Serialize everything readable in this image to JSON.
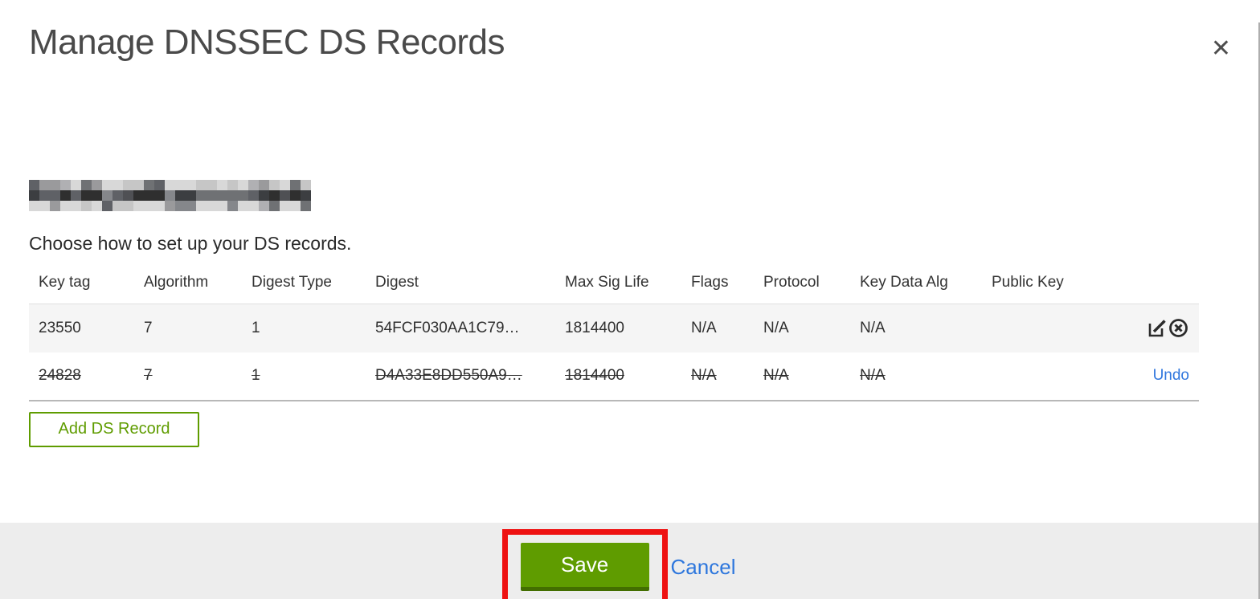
{
  "modal": {
    "title": "Manage DNSSEC DS Records",
    "close_icon": "✕",
    "intro": "Choose how to set up your DS records."
  },
  "redacted_domain": {
    "present": true,
    "palette": [
      "#2f2f2f",
      "#3c3e41",
      "#4f5054",
      "#5f6166",
      "#6f7174",
      "#85878b",
      "#9a9a9c",
      "#b0b0b3",
      "#c6c6c6",
      "#d8d8d8"
    ]
  },
  "table": {
    "headers": [
      "Key tag",
      "Algorithm",
      "Digest Type",
      "Digest",
      "Max Sig Life",
      "Flags",
      "Protocol",
      "Key Data Alg",
      "Public Key"
    ],
    "rows": [
      {
        "state": "active",
        "cells": [
          "23550",
          "7",
          "1",
          "54FCF030AA1C79…",
          "1814400",
          "N/A",
          "N/A",
          "N/A",
          ""
        ],
        "actions": [
          "edit",
          "delete"
        ]
      },
      {
        "state": "marked_for_deletion",
        "cells": [
          "24828",
          "7",
          "1",
          "D4A33E8DD550A9…",
          "1814400",
          "N/A",
          "N/A",
          "N/A",
          ""
        ],
        "actions": [
          "undo"
        ],
        "undo_label": "Undo"
      }
    ]
  },
  "buttons": {
    "add_ds_record": "Add DS Record",
    "save": "Save",
    "cancel": "Cancel"
  },
  "colors": {
    "accent_green": "#5f9c00",
    "accent_green_dark": "#436e00",
    "link_blue": "#3077de",
    "annotation_red": "#ee1111",
    "footer_gray": "#ededed"
  }
}
